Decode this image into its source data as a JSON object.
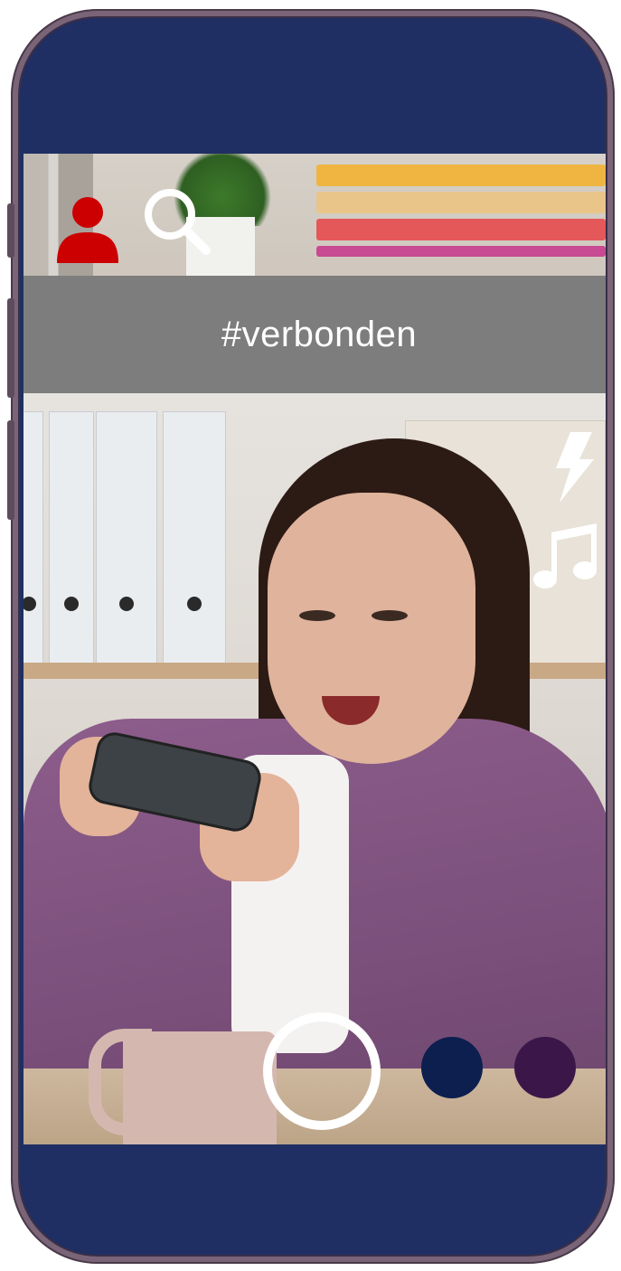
{
  "header": {
    "hashtag": "#verbonden"
  },
  "icons": {
    "profile": "profile-icon",
    "search": "search-icon",
    "flash": "flash-icon",
    "music": "music-note-icon"
  },
  "controls": {
    "color_options": [
      "#0c1f4f",
      "#3b1648"
    ]
  },
  "colors": {
    "phone_body": "#1f2f63",
    "profile_accent": "#cc0000",
    "hashtag_bar": "#7d7d7d",
    "icon_white": "#ffffff"
  }
}
